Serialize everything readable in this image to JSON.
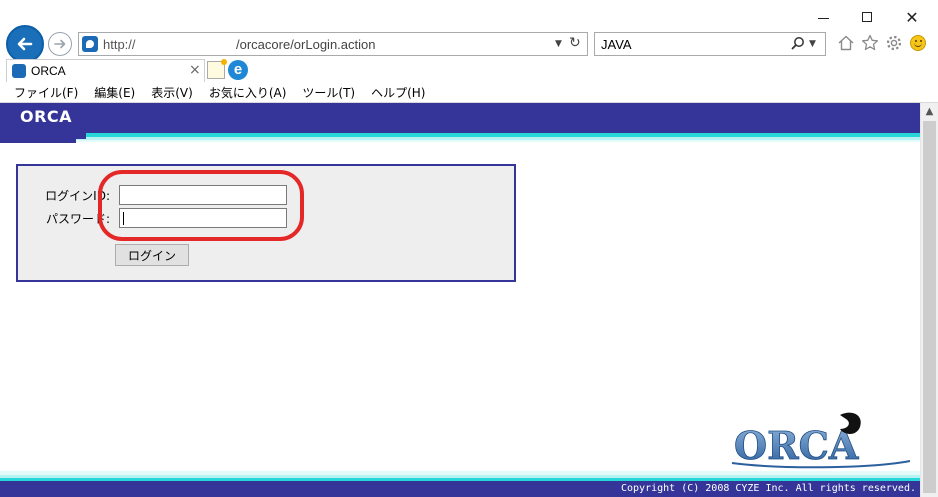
{
  "window": {
    "minimize_icon": "minimize-icon",
    "maximize_icon": "maximize-icon",
    "close_icon": "close-icon"
  },
  "toolbar": {
    "back_icon": "arrow-left-icon",
    "forward_icon": "arrow-right-icon",
    "address": {
      "protocol": "http://",
      "path": "/orcacore/orLogin.action"
    },
    "search": {
      "value": "JAVA"
    },
    "accent_color": "#1a6fb8"
  },
  "tabs": [
    {
      "title": "ORCA",
      "close": "×"
    }
  ],
  "menu": [
    "ファイル(F)",
    "編集(E)",
    "表示(V)",
    "お気に入り(A)",
    "ツール(T)",
    "ヘルプ(H)"
  ],
  "page": {
    "header_title": "ORCA",
    "header_color": "#353599",
    "stripe_color": "#27d6d6",
    "login": {
      "id_label": "ログインID:",
      "password_label": "パスワード:",
      "id_value": "",
      "password_value": "",
      "submit_label": "ログイン"
    },
    "highlight_color": "#e42727",
    "logo_text": "ORCA",
    "copyright": "Copyright (C) 2008 CYZE Inc. All rights reserved."
  }
}
